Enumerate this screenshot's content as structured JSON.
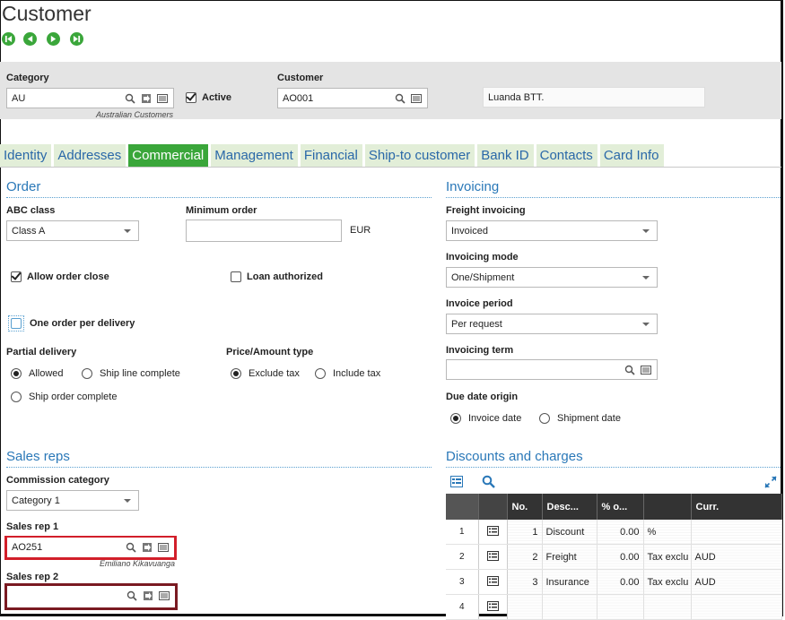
{
  "page": {
    "title": "Customer"
  },
  "header": {
    "category": {
      "label": "Category",
      "value": "AU",
      "hint": "Australian Customers"
    },
    "active": {
      "label": "Active",
      "checked": true
    },
    "customer": {
      "label": "Customer",
      "value": "AO001",
      "name": "Luanda BTT."
    }
  },
  "tabs": [
    "Identity",
    "Addresses",
    "Commercial",
    "Management",
    "Financial",
    "Ship-to customer",
    "Bank ID",
    "Contacts",
    "Card Info"
  ],
  "order": {
    "section": "Order",
    "abc_class": {
      "label": "ABC class",
      "value": "Class A"
    },
    "minimum_order": {
      "label": "Minimum order",
      "value": "",
      "currency": "EUR"
    },
    "allow_order_close": {
      "label": "Allow order close",
      "checked": true
    },
    "loan_authorized": {
      "label": "Loan authorized",
      "checked": false
    },
    "one_order_per_delivery": {
      "label": "One order per delivery",
      "checked": false
    },
    "partial_delivery": {
      "label": "Partial delivery",
      "options": [
        "Allowed",
        "Ship line complete",
        "Ship order complete"
      ],
      "selected": "Allowed"
    },
    "price_type": {
      "label": "Price/Amount type",
      "options": [
        "Exclude tax",
        "Include tax"
      ],
      "selected": "Exclude tax"
    }
  },
  "invoicing": {
    "section": "Invoicing",
    "freight_invoicing": {
      "label": "Freight invoicing",
      "value": "Invoiced"
    },
    "invoicing_mode": {
      "label": "Invoicing mode",
      "value": "One/Shipment"
    },
    "invoice_period": {
      "label": "Invoice period",
      "value": "Per request"
    },
    "invoicing_term": {
      "label": "Invoicing term",
      "value": ""
    },
    "due_date_origin": {
      "label": "Due date origin",
      "options": [
        "Invoice date",
        "Shipment date"
      ],
      "selected": "Invoice date"
    }
  },
  "sales_reps": {
    "section": "Sales reps",
    "commission_category": {
      "label": "Commission category",
      "value": "Category 1"
    },
    "rep1": {
      "label": "Sales rep 1",
      "value": "AO251",
      "hint": "Emiliano Kikavuanga"
    },
    "rep2": {
      "label": "Sales rep 2",
      "value": ""
    }
  },
  "discounts": {
    "section": "Discounts and charges",
    "columns": [
      "No.",
      "Desc...",
      "% o...",
      "",
      "Curr."
    ],
    "rows": [
      {
        "row": "1",
        "no": "1",
        "desc": "Discount",
        "pct": "0.00",
        "type": "%",
        "curr": ""
      },
      {
        "row": "2",
        "no": "2",
        "desc": "Freight",
        "pct": "0.00",
        "type": "Tax exclu",
        "curr": "AUD"
      },
      {
        "row": "3",
        "no": "3",
        "desc": "Insurance",
        "pct": "0.00",
        "type": "Tax exclu",
        "curr": "AUD"
      },
      {
        "row": "4",
        "no": "",
        "desc": "",
        "pct": "",
        "type": "",
        "curr": ""
      }
    ]
  },
  "colors": {
    "accent_green": "#3aa63a",
    "link_blue": "#2a78b8",
    "tab_bg": "#e2eed8",
    "highlight_red": "#d21f2a",
    "highlight_dark": "#7a1a22"
  }
}
